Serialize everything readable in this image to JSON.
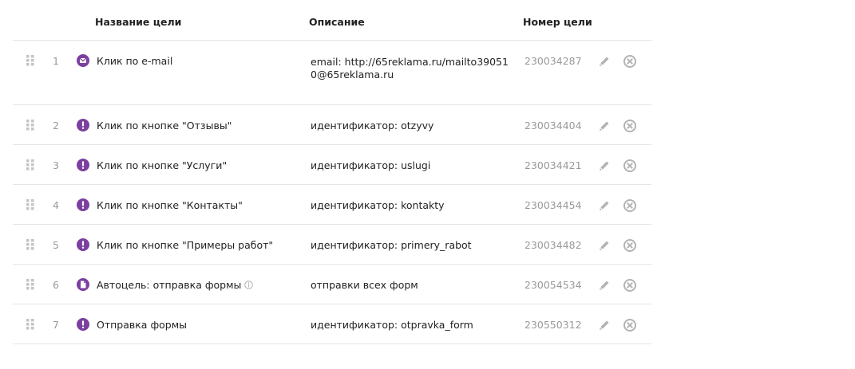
{
  "header": {
    "name": "Название цели",
    "description": "Описание",
    "number": "Номер цели"
  },
  "colors": {
    "accent_purple": "#7b3fa0",
    "icon_gray": "#b3b3b3",
    "text_muted": "#999999"
  },
  "goals": [
    {
      "index": "1",
      "type_icon": "mail-icon",
      "name": "Клик по e-mail",
      "description": "email: http://65reklama.ru/mailto390510@65reklama.ru",
      "id": "230034287"
    },
    {
      "index": "2",
      "type_icon": "exclamation-icon",
      "name": "Клик по кнопке \"Отзывы\"",
      "description": "идентификатор: otzyvy",
      "id": "230034404"
    },
    {
      "index": "3",
      "type_icon": "exclamation-icon",
      "name": "Клик по кнопке \"Услуги\"",
      "description": "идентификатор: uslugi",
      "id": "230034421"
    },
    {
      "index": "4",
      "type_icon": "exclamation-icon",
      "name": "Клик по кнопке \"Контакты\"",
      "description": "идентификатор: kontakty",
      "id": "230034454"
    },
    {
      "index": "5",
      "type_icon": "exclamation-icon",
      "name": "Клик по кнопке \"Примеры работ\"",
      "description": "идентификатор: primery_rabot",
      "id": "230034482"
    },
    {
      "index": "6",
      "type_icon": "form-icon",
      "name": "Автоцель: отправка формы",
      "description": "отправки всех форм",
      "id": "230054534"
    },
    {
      "index": "7",
      "type_icon": "exclamation-icon",
      "name": "Отправка формы",
      "description": "идентификатор: otpravka_form",
      "id": "230550312"
    }
  ]
}
